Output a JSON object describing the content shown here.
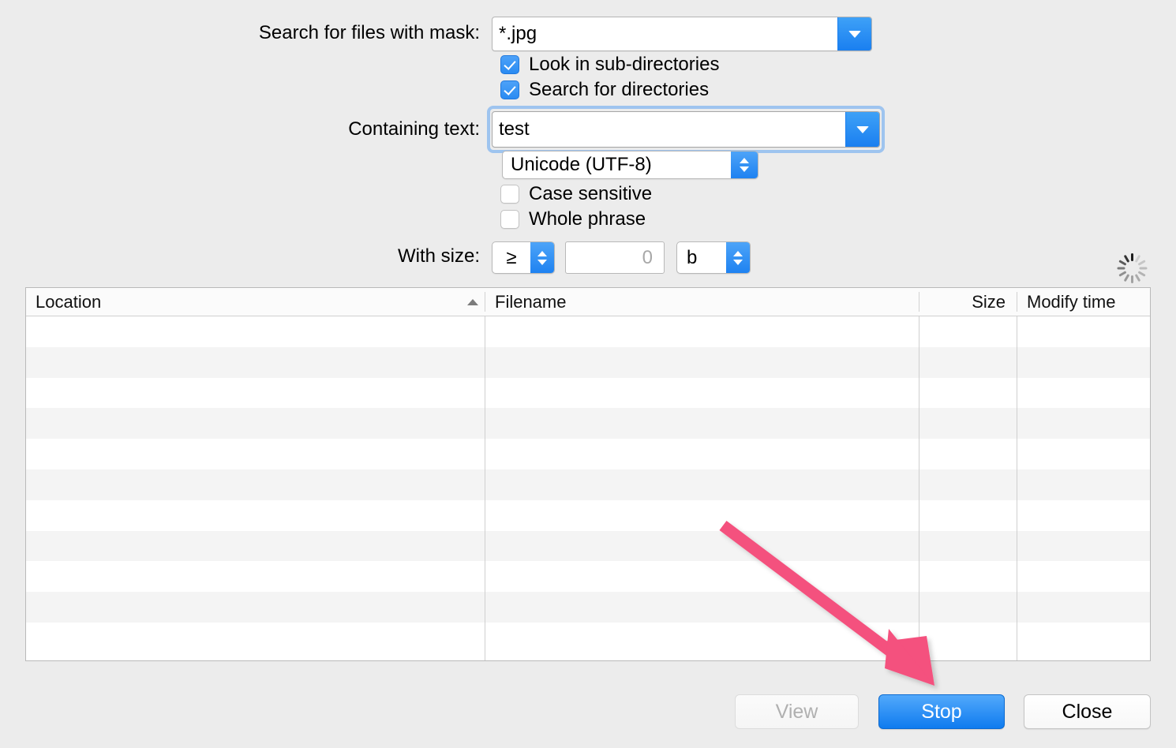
{
  "dialog": {
    "background_color": "#ececec",
    "accent_color": "#1a7ff0",
    "annotation_color": "#f4517e"
  },
  "fields": {
    "mask": {
      "label": "Search for files with mask:",
      "value": "*.jpg",
      "dropdown_icon": "chevron-down-icon"
    },
    "containing_text": {
      "label": "Containing text:",
      "value": "test",
      "dropdown_icon": "chevron-down-icon",
      "focused": "true"
    },
    "encoding": {
      "value": "Unicode (UTF-8)",
      "stepper_icon": "chevron-up-down-icon"
    },
    "size": {
      "label": "With size:",
      "comparator": "≥",
      "amount": "0",
      "unit": "b"
    }
  },
  "checkboxes": [
    {
      "label": "Look in sub-directories",
      "checked": "true"
    },
    {
      "label": "Search for directories",
      "checked": "true"
    },
    {
      "label": "Case sensitive",
      "checked": "false"
    },
    {
      "label": "Whole phrase",
      "checked": "false"
    }
  ],
  "status": {
    "busy_icon": "spinner-icon",
    "busy": "true"
  },
  "results": {
    "columns": [
      {
        "label": "Location",
        "sorted": "ascending",
        "sort_icon": "sort-ascending-icon"
      },
      {
        "label": "Filename",
        "sorted": "none"
      },
      {
        "label": "Size",
        "sorted": "none"
      },
      {
        "label": "Modify time",
        "sorted": "none"
      }
    ],
    "rows": []
  },
  "buttons": {
    "view": {
      "label": "View",
      "state": "disabled"
    },
    "stop": {
      "label": "Stop",
      "state": "default"
    },
    "close": {
      "label": "Close",
      "state": "normal"
    }
  }
}
